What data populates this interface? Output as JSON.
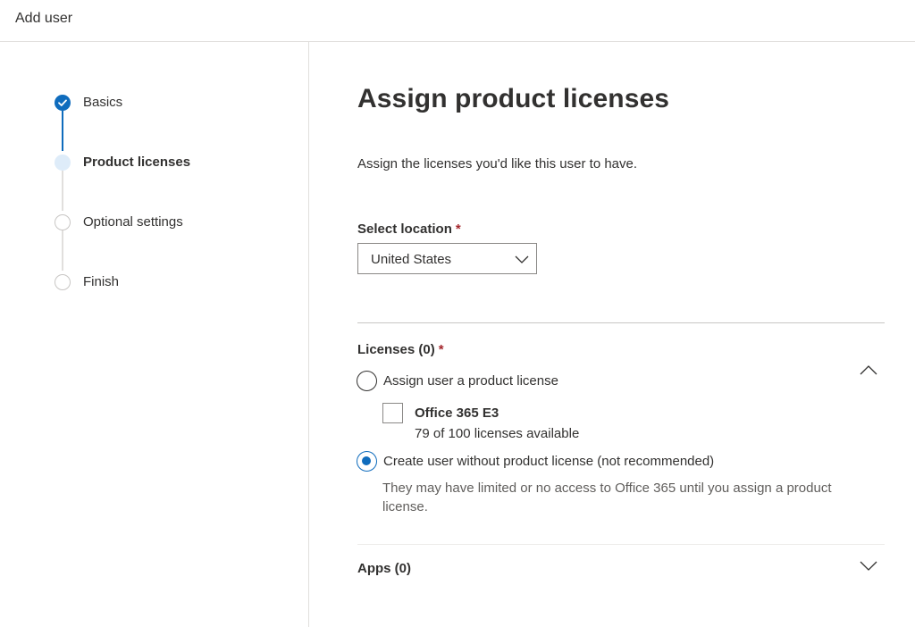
{
  "header": {
    "title": "Add user"
  },
  "stepper": {
    "steps": [
      {
        "label": "Basics",
        "state": "completed"
      },
      {
        "label": "Product licenses",
        "state": "current"
      },
      {
        "label": "Optional settings",
        "state": "pending"
      },
      {
        "label": "Finish",
        "state": "pending"
      }
    ]
  },
  "main": {
    "title": "Assign product licenses",
    "subtitle": "Assign the licenses you'd like this user to have.",
    "location": {
      "label": "Select location",
      "required_marker": "*",
      "value": "United States"
    },
    "licenses": {
      "label": "Licenses (0)",
      "required_marker": "*",
      "expanded": true,
      "options": [
        {
          "label": "Assign user a product license",
          "selected": false
        },
        {
          "label": "Create user without product license (not recommended)",
          "selected": true
        }
      ],
      "products": [
        {
          "name": "Office 365 E3",
          "availability": "79 of 100 licenses available",
          "checked": false
        }
      ],
      "note": "They may have limited or no access to Office 365 until you assign a product license."
    },
    "apps": {
      "label": "Apps (0)",
      "expanded": false
    }
  },
  "colors": {
    "accent": "#0f6cbd",
    "accent_light": "#deecf9",
    "required": "#a4262c",
    "muted_text": "#605e5c",
    "border": "#c8c6c4"
  },
  "icons": {
    "step_completed": "checkmark-icon",
    "location_dropdown": "chevron-down-icon",
    "licenses_toggle": "chevron-up-icon",
    "apps_toggle": "chevron-down-icon"
  }
}
